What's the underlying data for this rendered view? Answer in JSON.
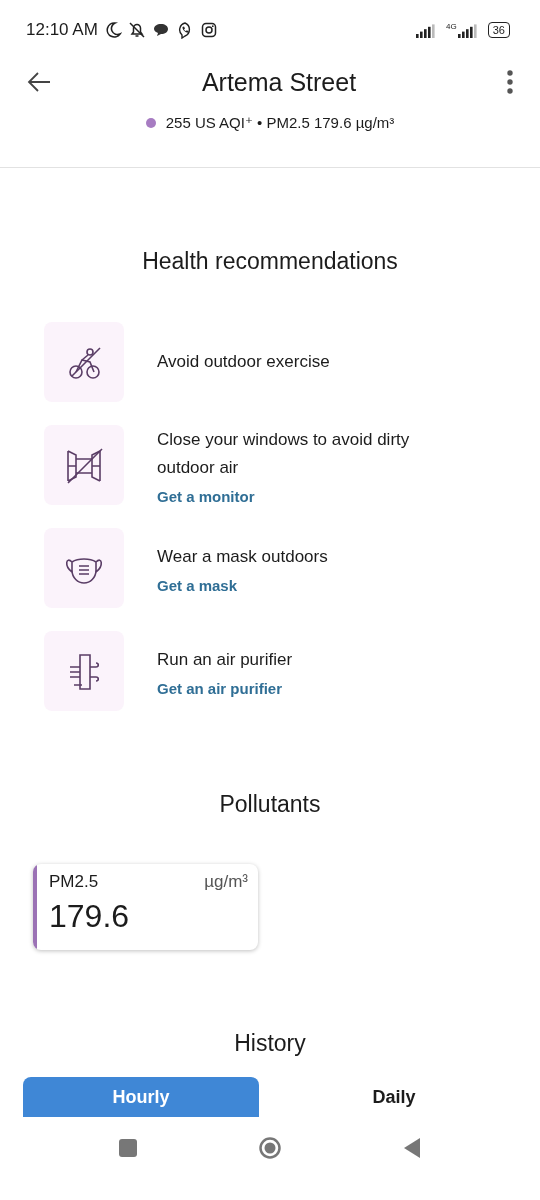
{
  "status_bar": {
    "time": "12:10 AM",
    "battery": "36",
    "network": "4G"
  },
  "header": {
    "title": "Artema Street",
    "aqi": {
      "text": "255 US AQI⁺ • PM2.5 179.6 µg/m³",
      "color": "#a77cc2"
    }
  },
  "health": {
    "title": "Health recommendations",
    "items": [
      {
        "kind": "exercise",
        "text": "Avoid outdoor exercise"
      },
      {
        "kind": "windows",
        "text": "Close your windows to avoid dirty outdoor air",
        "link": "Get a monitor"
      },
      {
        "kind": "mask",
        "text": "Wear a mask outdoors",
        "link": "Get a mask"
      },
      {
        "kind": "purifier",
        "text": "Run an air purifier",
        "link": "Get an air purifier"
      }
    ]
  },
  "pollutants": {
    "title": "Pollutants",
    "cards": [
      {
        "name": "PM2.5",
        "unit": "µg/m³",
        "value": "179.6",
        "color": "#9b72b5"
      }
    ]
  },
  "history": {
    "title": "History",
    "tabs": [
      {
        "label": "Hourly",
        "selected": true
      },
      {
        "label": "Daily",
        "selected": false
      }
    ]
  }
}
